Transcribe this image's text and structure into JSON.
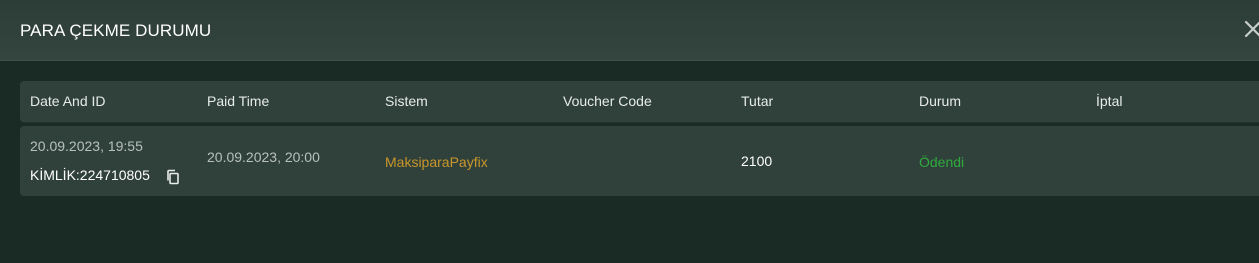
{
  "modal": {
    "title": "PARA ÇEKME DURUMU"
  },
  "table": {
    "headers": [
      "Date And ID",
      "Paid Time",
      "Sistem",
      "Voucher Code",
      "Tutar",
      "Durum",
      "İptal"
    ],
    "rows": [
      {
        "date": "20.09.2023, 19:55",
        "id_label": "KİMLİK:224710805",
        "paid_time": "20.09.2023, 20:00",
        "sistem": "MaksiparaPayfix",
        "voucher_code": "",
        "tutar": "2100",
        "durum": "Ödendi",
        "iptal": ""
      }
    ]
  },
  "icons": {
    "close": "close-icon",
    "copy": "copy-icon"
  },
  "colors": {
    "background": "#1a2b25",
    "header": "#30413b",
    "sistem": "#c9962a",
    "status_paid": "#2faa3c"
  }
}
